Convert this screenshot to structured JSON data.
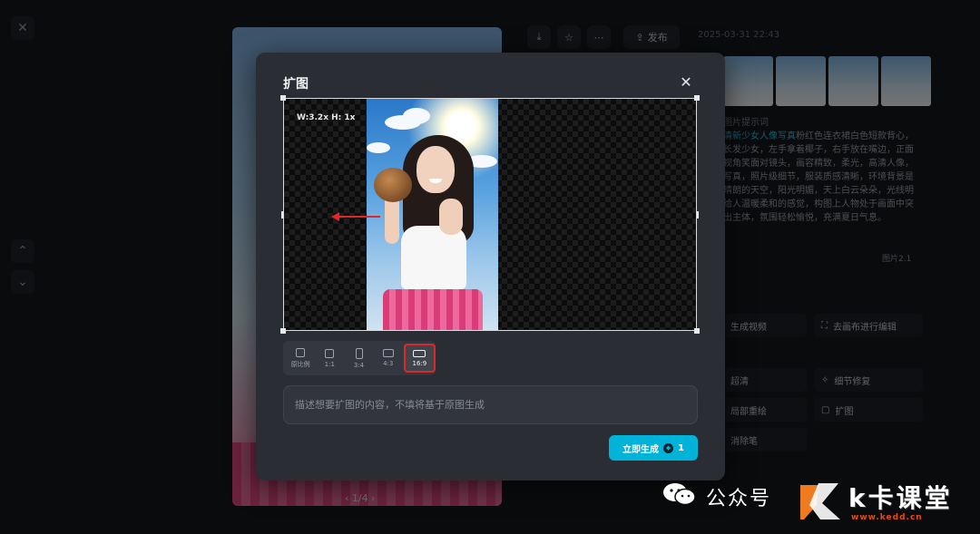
{
  "background": {
    "close_icon": "close-icon",
    "pager_text": "1/4",
    "toolbar": {
      "download_icon": "download-icon",
      "star_icon": "star-icon",
      "more_icon": "more-icon",
      "publish_label": "发布"
    },
    "date": "2025-03-31 22:43",
    "prompt_header": "图片提示词",
    "prompt_highlight": "清新少女人像写真",
    "prompt_text": "粉红色连衣裙白色短款背心，长发少女，左手拿着椰子，右手放在嘴边，正面视角笑面对镜头，画容精致，柔光，高清人像，写真，照片级细节，服装质感清晰，环境背景是晴朗的天空，阳光明媚，天上白云朵朵，光线明给人温暖柔和的感觉，构图上人物处于画面中突出主体，氛围轻松愉悦，充满夏日气息。",
    "model_tag": "图片2.1",
    "actions": {
      "generate_video": "生成视频",
      "canvas_edit": "去画布进行编辑",
      "hd": "超清",
      "detail_fix": "细节修复",
      "inpaint": "局部重绘",
      "expand": "扩图",
      "eraser": "消除笔"
    }
  },
  "modal": {
    "title": "扩图",
    "size_label": "W:3.2x H: 1x",
    "ratios": [
      {
        "label": "原比例"
      },
      {
        "label": "1:1"
      },
      {
        "label": "3:4"
      },
      {
        "label": "4:3"
      },
      {
        "label": "16:9"
      }
    ],
    "selected_ratio": "16:9",
    "description_placeholder": "描述想要扩图的内容，不填将基于原图生成",
    "description_value": "",
    "generate_label": "立即生成",
    "generate_cost": "1",
    "accent_color": "#00b3d9",
    "highlight_color": "#d92a2a"
  },
  "watermark": {
    "channel_text": "公众号",
    "brand_text": "k卡课堂",
    "url": "www.kedd.cn"
  }
}
